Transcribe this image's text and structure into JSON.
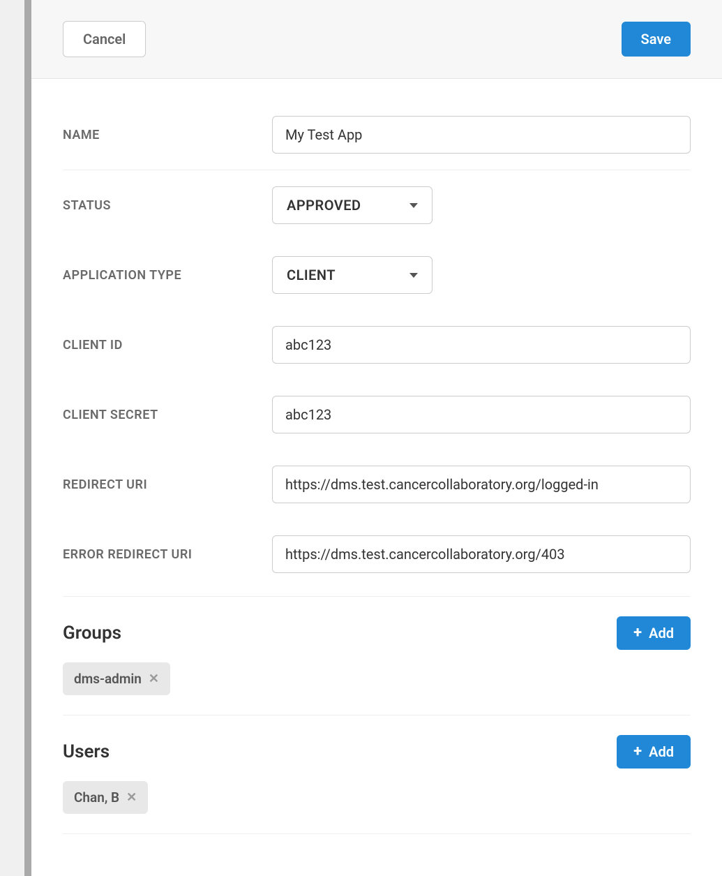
{
  "header": {
    "cancel_label": "Cancel",
    "save_label": "Save"
  },
  "form": {
    "name": {
      "label": "NAME",
      "value": "My Test App"
    },
    "status": {
      "label": "STATUS",
      "value": "APPROVED"
    },
    "app_type": {
      "label": "APPLICATION TYPE",
      "value": "CLIENT"
    },
    "client_id": {
      "label": "CLIENT ID",
      "value": "abc123"
    },
    "client_secret": {
      "label": "CLIENT SECRET",
      "value": "abc123"
    },
    "redirect_uri": {
      "label": "REDIRECT URI",
      "value": "https://dms.test.cancercollaboratory.org/logged-in"
    },
    "error_redirect_uri": {
      "label": "ERROR REDIRECT URI",
      "value": "https://dms.test.cancercollaboratory.org/403"
    }
  },
  "sections": {
    "groups": {
      "title": "Groups",
      "add_label": "Add",
      "items": [
        {
          "label": "dms-admin"
        }
      ]
    },
    "users": {
      "title": "Users",
      "add_label": "Add",
      "items": [
        {
          "label": "Chan, B"
        }
      ]
    }
  }
}
